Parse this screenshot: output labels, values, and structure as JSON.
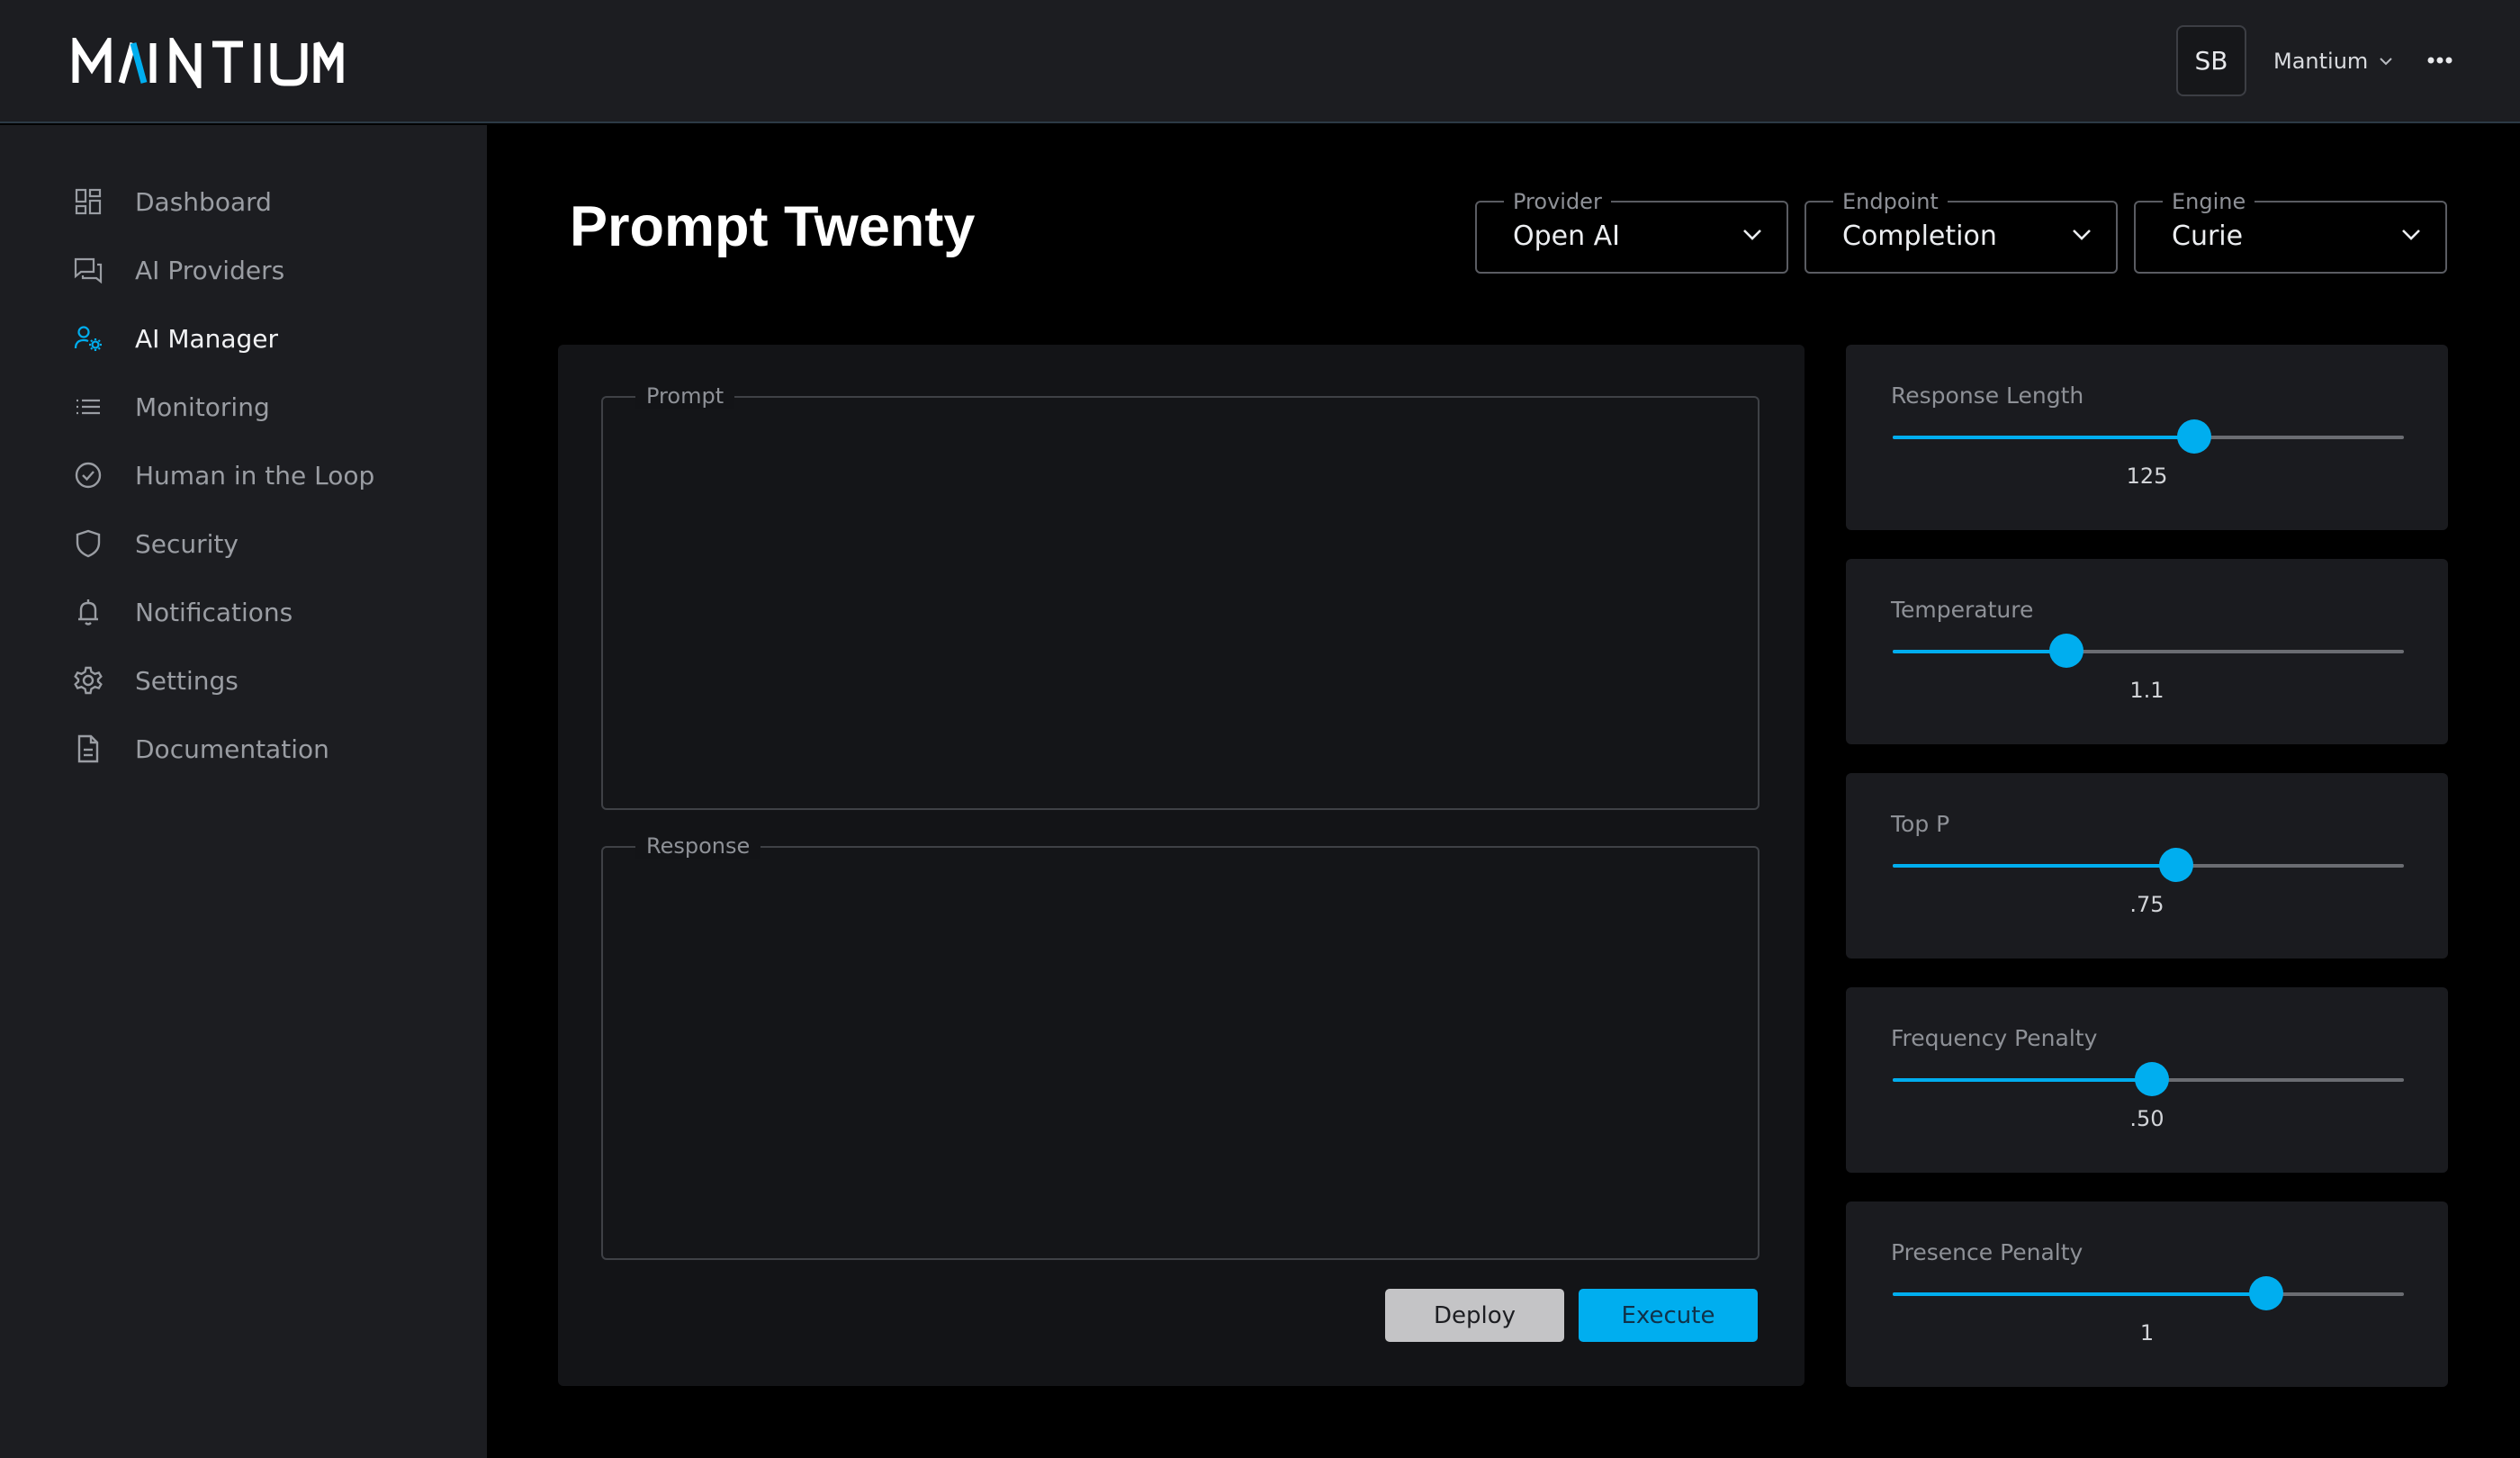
{
  "brand": {
    "logo_text": "MANTIUM",
    "accent_color": "#00aeef"
  },
  "header": {
    "avatar_initials": "SB",
    "org_name": "Mantium"
  },
  "sidebar": {
    "items": [
      {
        "label": "Dashboard",
        "icon": "dashboard-icon",
        "active": false
      },
      {
        "label": "AI Providers",
        "icon": "chat-icon",
        "active": false
      },
      {
        "label": "AI Manager",
        "icon": "user-gear-icon",
        "active": true
      },
      {
        "label": "Monitoring",
        "icon": "list-icon",
        "active": false
      },
      {
        "label": "Human in the Loop",
        "icon": "check-circle-icon",
        "active": false
      },
      {
        "label": "Security",
        "icon": "shield-icon",
        "active": false
      },
      {
        "label": "Notifications",
        "icon": "bell-icon",
        "active": false
      },
      {
        "label": "Settings",
        "icon": "gear-icon",
        "active": false
      },
      {
        "label": "Documentation",
        "icon": "document-icon",
        "active": false
      }
    ]
  },
  "page": {
    "title": "Prompt Twenty"
  },
  "selects": {
    "provider": {
      "label": "Provider",
      "value": "Open AI"
    },
    "endpoint": {
      "label": "Endpoint",
      "value": "Completion"
    },
    "engine": {
      "label": "Engine",
      "value": "Curie"
    }
  },
  "editor": {
    "prompt": {
      "label": "Prompt",
      "value": ""
    },
    "response": {
      "label": "Response",
      "value": ""
    },
    "deploy_label": "Deploy",
    "execute_label": "Execute"
  },
  "parameters": [
    {
      "label": "Response Length",
      "value": "125",
      "position": 0.59
    },
    {
      "label": "Temperature",
      "value": "1.1",
      "position": 0.34
    },
    {
      "label": "Top P",
      "value": ".75",
      "position": 0.555
    },
    {
      "label": "Frequency Penalty",
      "value": ".50",
      "position": 0.507
    },
    {
      "label": "Presence Penalty",
      "value": "1",
      "position": 0.73
    }
  ]
}
